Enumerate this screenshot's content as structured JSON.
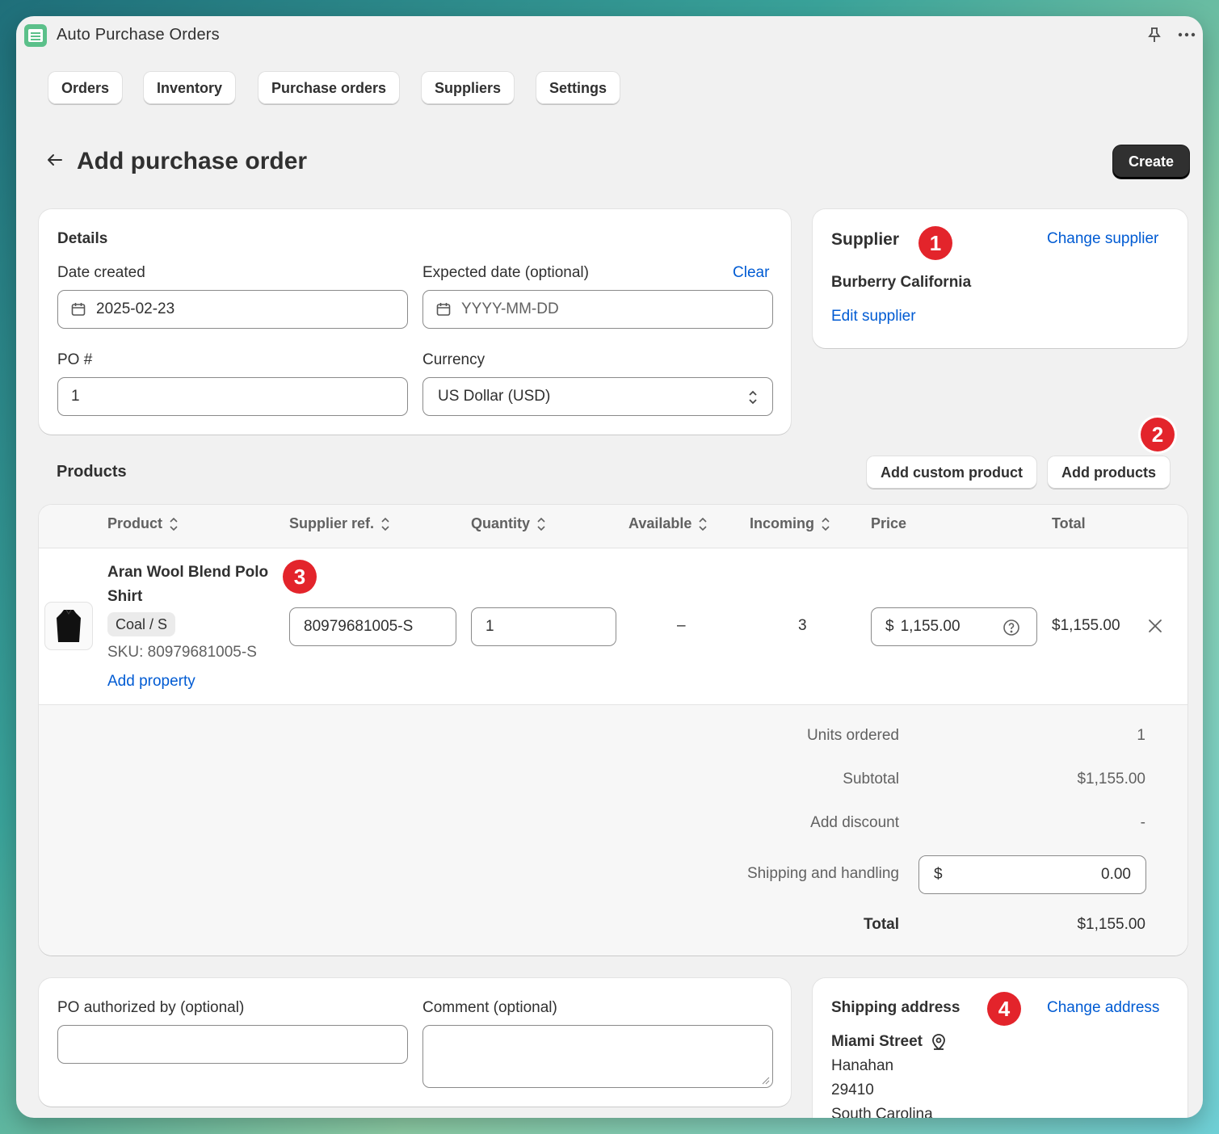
{
  "app": {
    "title": "Auto Purchase Orders"
  },
  "nav": [
    {
      "label": "Orders"
    },
    {
      "label": "Inventory"
    },
    {
      "label": "Purchase orders"
    },
    {
      "label": "Suppliers"
    },
    {
      "label": "Settings"
    }
  ],
  "page": {
    "title": "Add purchase order",
    "create_label": "Create"
  },
  "details": {
    "heading": "Details",
    "date_created_label": "Date created",
    "date_created_value": "2025-02-23",
    "expected_label": "Expected date (optional)",
    "expected_placeholder": "YYYY-MM-DD",
    "clear_label": "Clear",
    "po_label": "PO #",
    "po_value": "1",
    "currency_label": "Currency",
    "currency_value": "US Dollar (USD)"
  },
  "supplier": {
    "heading": "Supplier",
    "change_label": "Change supplier",
    "name": "Burberry California",
    "edit_label": "Edit supplier"
  },
  "badges": [
    "1",
    "2",
    "3",
    "4"
  ],
  "products": {
    "heading": "Products",
    "add_custom_label": "Add custom product",
    "add_products_label": "Add products",
    "columns": [
      "Product",
      "Supplier ref.",
      "Quantity",
      "Available",
      "Incoming",
      "Price",
      "Total"
    ],
    "rows": [
      {
        "name_line1": "Aran Wool Blend Polo",
        "name_line2": "Shirt",
        "variant": "Coal / S",
        "sku": "SKU: 80979681005-S",
        "add_property": "Add property",
        "supplier_ref": "80979681005-S",
        "quantity": "1",
        "available": "–",
        "incoming": "3",
        "price_currency": "$",
        "price": "1,155.00",
        "total": "$1,155.00"
      }
    ]
  },
  "summary": {
    "units_label": "Units ordered",
    "units_value": "1",
    "subtotal_label": "Subtotal",
    "subtotal_value": "$1,155.00",
    "discount_label": "Add discount",
    "discount_value": "-",
    "shipping_label": "Shipping and handling",
    "shipping_currency": "$",
    "shipping_value": "0.00",
    "total_label": "Total",
    "total_value": "$1,155.00"
  },
  "footer": {
    "authorized_label": "PO authorized by (optional)",
    "comment_label": "Comment (optional)"
  },
  "shipping_address": {
    "heading": "Shipping address",
    "change_label": "Change address",
    "street": "Miami Street",
    "city": "Hanahan",
    "zip": "29410",
    "state": "South Carolina"
  }
}
